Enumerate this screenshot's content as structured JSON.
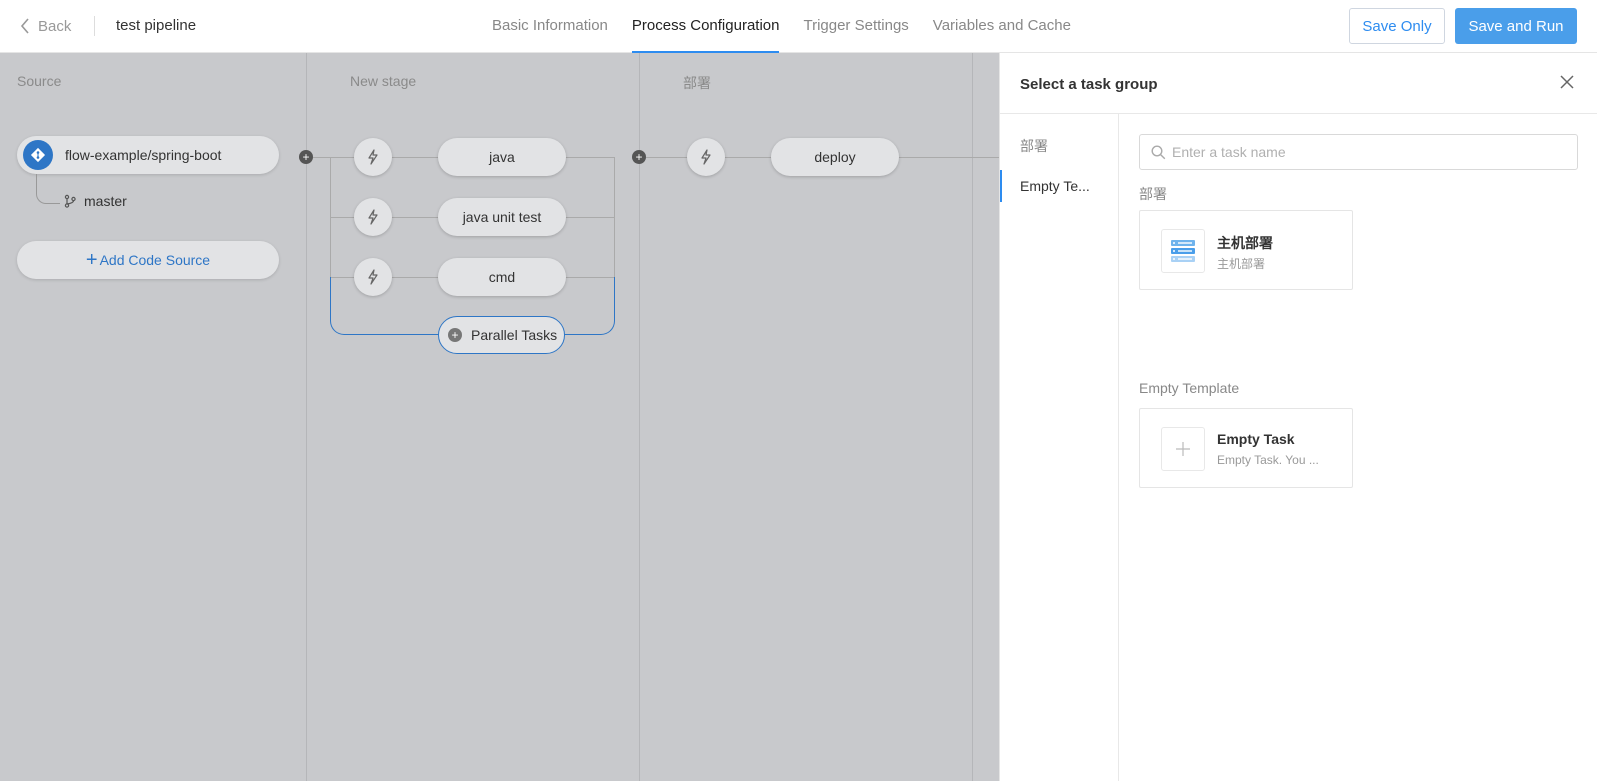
{
  "header": {
    "back_label": "Back",
    "pipeline_name": "test pipeline",
    "tabs": [
      {
        "label": "Basic Information"
      },
      {
        "label": "Process Configuration"
      },
      {
        "label": "Trigger Settings"
      },
      {
        "label": "Variables and Cache"
      }
    ],
    "active_tab": "Process Configuration",
    "save_only_label": "Save Only",
    "save_run_label": "Save and Run"
  },
  "canvas": {
    "source": {
      "title": "Source",
      "repo": "flow-example/spring-boot",
      "branch": "master",
      "add_label": "Add Code Source"
    },
    "stages": [
      {
        "title": "New stage",
        "jobs": [
          "java",
          "java unit test",
          "cmd"
        ],
        "parallel_label": "Parallel Tasks"
      },
      {
        "title": "部署",
        "jobs": [
          "deploy"
        ]
      }
    ]
  },
  "drawer": {
    "title": "Select a task group",
    "nav": [
      {
        "label": "部署"
      },
      {
        "label": "Empty Te..."
      }
    ],
    "search_placeholder": "Enter a task name",
    "groups": [
      {
        "title": "部署",
        "card": {
          "title": "主机部署",
          "desc": "主机部署",
          "icon": "server-stack-icon"
        }
      },
      {
        "title": "Empty Template",
        "card": {
          "title": "Empty Task",
          "desc": "Empty Task. You ...",
          "icon": "plus-icon"
        }
      }
    ]
  },
  "colors": {
    "accent": "#2d8cf0",
    "primary_button": "#4a9eea",
    "canvas_bg": "#c8c9cc",
    "git_badge": "#2e76c6"
  }
}
